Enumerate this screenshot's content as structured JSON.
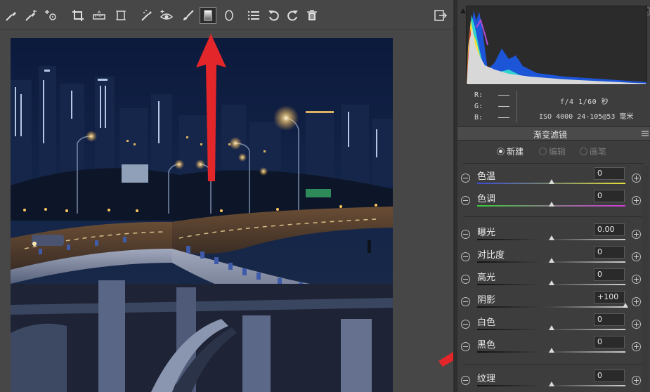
{
  "toolbar": {
    "tools": [
      "white-balance-icon",
      "color-sampler-icon",
      "target-adjust-icon",
      "crop-icon",
      "straighten-icon",
      "transform-icon",
      "spot-removal-icon",
      "red-eye-icon",
      "adjustment-brush-icon",
      "graduated-filter-icon",
      "radial-filter-icon",
      "presets-list-icon",
      "rotate-ccw-icon",
      "rotate-cw-icon",
      "delete-icon"
    ],
    "active_tool": "graduated-filter-icon",
    "right_icon": "open-preferences-icon"
  },
  "info": {
    "r_label": "R:",
    "g_label": "G:",
    "b_label": "B:",
    "exif_line1": "f/4  1/60 秒",
    "exif_line2": "ISO 4000  24-105@53 毫米"
  },
  "panel": {
    "title": "渐变滤镜",
    "modes": [
      {
        "label": "新建",
        "selected": true,
        "enabled": true
      },
      {
        "label": "编辑",
        "selected": false,
        "enabled": false
      },
      {
        "label": "画笔",
        "selected": false,
        "enabled": false
      }
    ],
    "sliders": [
      {
        "label": "色温",
        "value": "0",
        "position": 0.5,
        "track": "temp"
      },
      {
        "label": "色调",
        "value": "0",
        "position": 0.5,
        "track": "tint"
      },
      {
        "label": "曝光",
        "value": "0.00",
        "position": 0.5,
        "track": "gray"
      },
      {
        "label": "对比度",
        "value": "0",
        "position": 0.5,
        "track": "gray"
      },
      {
        "label": "高光",
        "value": "0",
        "position": 0.5,
        "track": "gray"
      },
      {
        "label": "阴影",
        "value": "+100",
        "position": 1.0,
        "track": "gray"
      },
      {
        "label": "白色",
        "value": "0",
        "position": 0.5,
        "track": "gray"
      },
      {
        "label": "黑色",
        "value": "0",
        "position": 0.5,
        "track": "gray"
      },
      {
        "label": "纹理",
        "value": "0",
        "position": 0.5,
        "track": "gray"
      }
    ]
  },
  "colors": {
    "background": "#474747",
    "panel": "#3d3d3d",
    "annotation_red": "#e3262a"
  }
}
